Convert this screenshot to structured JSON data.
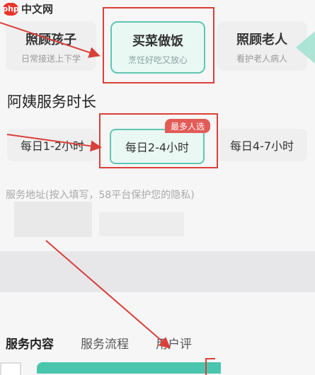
{
  "watermark": {
    "logo": "php",
    "text": "中文网"
  },
  "services": [
    {
      "title": "照顾孩子",
      "subtitle": "日常接送上下学",
      "selected": false
    },
    {
      "title": "买菜做饭",
      "subtitle": "烹饪好吃又放心",
      "selected": true
    },
    {
      "title": "照顾老人",
      "subtitle": "看护老人病人",
      "selected": false
    }
  ],
  "duration": {
    "section_title": "阿姨服务时长",
    "options": [
      "每日1-2小时",
      "每日2-4小时",
      "每日4-7小时"
    ],
    "selected_index": 1,
    "badge": "最多人选"
  },
  "privacy_note": "服务地址(按入填写，58平台保护您的隐私)",
  "tabs": [
    "服务内容",
    "服务流程",
    "用户评"
  ],
  "colors": {
    "accent": "#5fc6b3",
    "annotation_red": "#d9403a",
    "bar": "#49c6ad",
    "badge": "#e25b57"
  }
}
